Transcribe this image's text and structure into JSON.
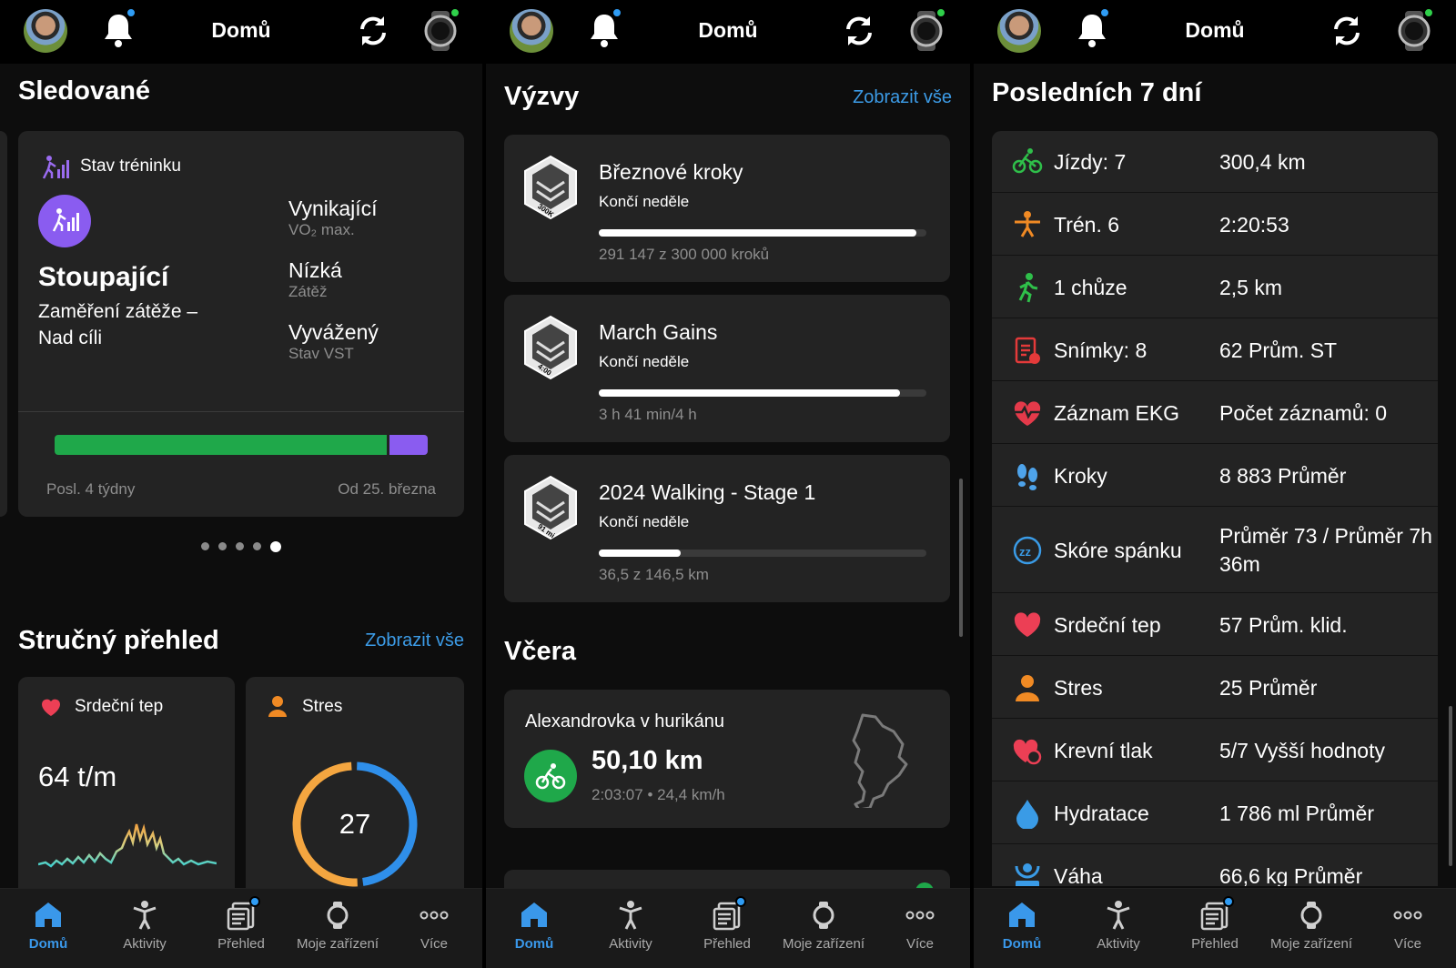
{
  "topbar": {
    "title": "Domů"
  },
  "nav": {
    "items": [
      {
        "label": "Domů",
        "icon": "home-icon",
        "active": true
      },
      {
        "label": "Aktivity",
        "icon": "activity-person-icon"
      },
      {
        "label": "Přehled",
        "icon": "news-feed-icon"
      },
      {
        "label": "Moje zařízení",
        "icon": "watch-icon"
      },
      {
        "label": "Více",
        "icon": "more-dots-icon"
      }
    ]
  },
  "panel1": {
    "section_title": "Sledované",
    "training": {
      "header": "Stav tréninku",
      "status": "Stoupající",
      "focus_line1": "Zaměření zátěže –",
      "focus_line2": "Nad cíli",
      "metrics": [
        {
          "value": "Vynikající",
          "label": "VO₂ max."
        },
        {
          "value": "Nízká",
          "label": "Zátěž"
        },
        {
          "value": "Vyvážený",
          "label": "Stav VST"
        }
      ],
      "bar_green_fraction": 0.89,
      "bar_left_label": "Posl. 4 týdny",
      "bar_right_label": "Od 25. března"
    },
    "pager": {
      "count": 5,
      "active_index": 4
    },
    "summary_title": "Stručný přehled",
    "summary_link": "Zobrazit vše",
    "heart_card": {
      "title": "Srdeční tep",
      "value": "64 t/m"
    },
    "stress_card": {
      "title": "Stres",
      "value": "27"
    }
  },
  "panel2": {
    "section_title": "Výzvy",
    "link": "Zobrazit vše",
    "challenges": [
      {
        "title": "Březnové kroky",
        "subtitle": "Končí neděle",
        "progress": 0.97,
        "detail": "291 147 z 300 000 kroků",
        "badge_text": "300K"
      },
      {
        "title": "March Gains",
        "subtitle": "Končí neděle",
        "progress": 0.92,
        "detail": "3 h 41 min/4 h",
        "badge_text": "4:00"
      },
      {
        "title": "2024 Walking - Stage 1",
        "subtitle": "Končí neděle",
        "progress": 0.25,
        "detail": "36,5 z 146,5 km",
        "badge_text": "91 mi"
      }
    ],
    "yesterday_title": "Včera",
    "activity": {
      "name": "Alexandrovka v hurikánu",
      "distance": "50,10 km",
      "stats": "2:03:07 • 24,4 km/h"
    }
  },
  "panel3": {
    "section_title": "Posledních 7 dní",
    "rows": [
      {
        "icon": "bike-icon",
        "color": "#2fbf4a",
        "label": "Jízdy: 7",
        "value": "300,4 km"
      },
      {
        "icon": "strength-icon",
        "color": "#f08a24",
        "label": "Trén. 6",
        "value": "2:20:53"
      },
      {
        "icon": "walk-icon",
        "color": "#2fbf4a",
        "label": "1 chůze",
        "value": "2,5 km"
      },
      {
        "icon": "clipboard-icon",
        "color": "#e43a3a",
        "label": "Snímky: 8",
        "value": "62 Prům. ST"
      },
      {
        "icon": "ecg-heart-icon",
        "color": "#e43a4a",
        "label": "Záznam EKG",
        "value": "Počet záznamů: 0"
      },
      {
        "icon": "footsteps-icon",
        "color": "#4ea3ea",
        "label": "Kroky",
        "value": "8 883 Průměr"
      },
      {
        "icon": "sleep-icon",
        "color": "#3a9be6",
        "label": "Skóre spánku",
        "value": "Průměr 73 / Průměr 7h 36m"
      },
      {
        "icon": "heart-icon",
        "color": "#ec3f55",
        "label": "Srdeční tep",
        "value": "57 Prům. klid."
      },
      {
        "icon": "stress-icon",
        "color": "#f08a24",
        "label": "Stres",
        "value": "25 Průměr"
      },
      {
        "icon": "blood-pressure-icon",
        "color": "#ec3f55",
        "label": "Krevní tlak",
        "value": "5/7 Vyšší hodnoty"
      },
      {
        "icon": "water-drop-icon",
        "color": "#3a9be6",
        "label": "Hydratace",
        "value": "1 786 ml Průměr"
      },
      {
        "icon": "scale-icon",
        "color": "#3a9be6",
        "label": "Váha",
        "value": "66,6 kg Průměr"
      }
    ]
  }
}
